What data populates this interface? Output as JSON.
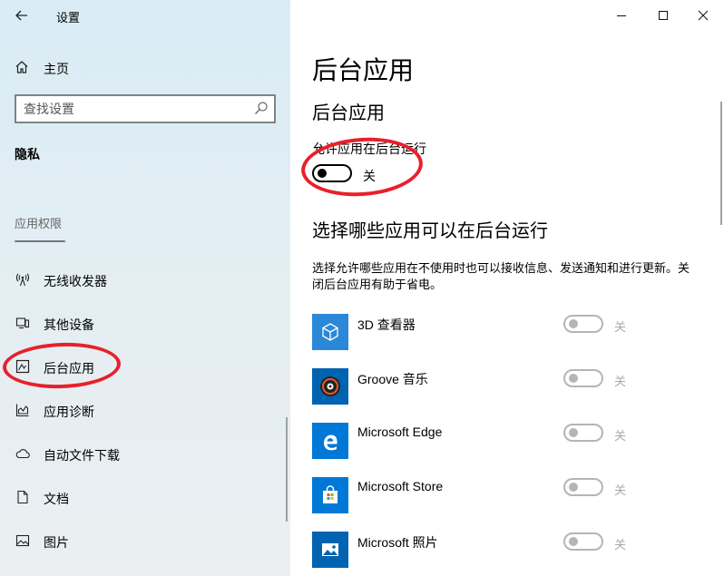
{
  "window": {
    "title": "设置",
    "controls": {
      "minimize": "minimize-icon",
      "maximize": "maximize-icon",
      "close": "close-icon"
    }
  },
  "sidebar": {
    "home": {
      "label": "主页",
      "icon": "home-icon"
    },
    "search": {
      "placeholder": "查找设置",
      "icon": "search-icon"
    },
    "section_title": "隐私",
    "group_title": "应用权限",
    "items": [
      {
        "label": "无线收发器",
        "icon": "radio-tower-icon"
      },
      {
        "label": "其他设备",
        "icon": "devices-icon"
      },
      {
        "label": "后台应用",
        "icon": "background-apps-icon"
      },
      {
        "label": "应用诊断",
        "icon": "diagnostics-icon"
      },
      {
        "label": "自动文件下载",
        "icon": "cloud-icon"
      },
      {
        "label": "文档",
        "icon": "document-icon"
      },
      {
        "label": "图片",
        "icon": "picture-icon"
      }
    ]
  },
  "main": {
    "page_title": "后台应用",
    "section_title": "后台应用",
    "allow_label": "允许应用在后台运行",
    "allow_toggle": {
      "state_label": "关"
    },
    "choose_title": "选择哪些应用可以在后台运行",
    "description": "选择允许哪些应用在不使用时也可以接收信息、发送通知和进行更新。关闭后台应用有助于省电。",
    "apps": [
      {
        "name": "3D 查看器",
        "state_label": "关",
        "icon": "cube-icon",
        "tile_color": "#2b88d8"
      },
      {
        "name": "Groove 音乐",
        "state_label": "关",
        "icon": "music-disc-icon",
        "tile_color": "#0063b1"
      },
      {
        "name": "Microsoft Edge",
        "state_label": "关",
        "icon": "edge-icon",
        "tile_color": "#0078d7"
      },
      {
        "name": "Microsoft Store",
        "state_label": "关",
        "icon": "store-bag-icon",
        "tile_color": "#0078d7"
      },
      {
        "name": "Microsoft 照片",
        "state_label": "关",
        "icon": "photos-icon",
        "tile_color": "#0063b1"
      }
    ]
  }
}
